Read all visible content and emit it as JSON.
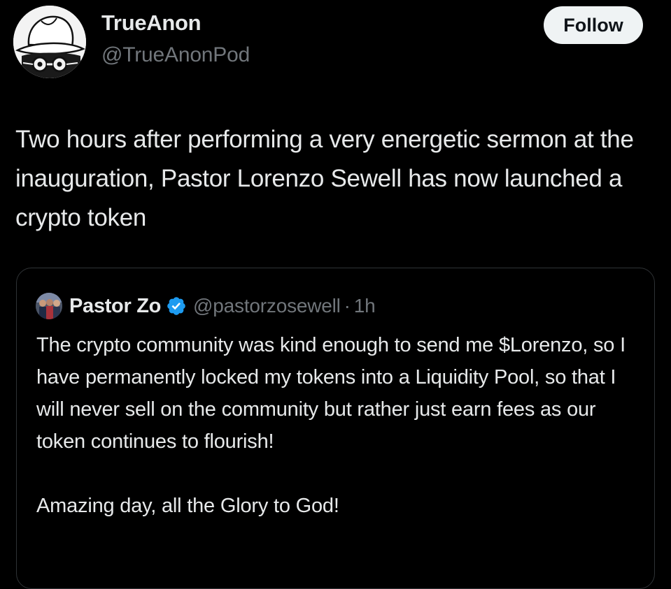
{
  "author": {
    "display_name": "TrueAnon",
    "handle": "@TrueAnonPod",
    "avatar_icon": "cartoon-hat-glasses-avatar"
  },
  "follow_label": "Follow",
  "post_text": "Two hours after performing a very energetic sermon at the inauguration, Pastor Lorenzo Sewell has now launched a crypto token",
  "quoted_post": {
    "author": {
      "display_name": "Pastor Zo",
      "handle": "@pastorzosewell",
      "verified": true,
      "verified_icon": "verified-badge-icon",
      "avatar_icon": "group-photo-avatar"
    },
    "separator": "·",
    "time": "1h",
    "paragraphs": [
      "The crypto community was kind enough to send me $Lorenzo, so I have permanently locked my tokens into a Liquidity Pool, so that I will never sell on the community but rather just earn fees as our token continues to flourish!",
      "Amazing day, all the Glory to God!"
    ]
  },
  "colors": {
    "background": "#000000",
    "primary_text": "#e7e9ea",
    "secondary_text": "#71767b",
    "border": "#2f3336",
    "follow_button_bg": "#eff3f4",
    "verified_blue": "#1d9bf0"
  }
}
